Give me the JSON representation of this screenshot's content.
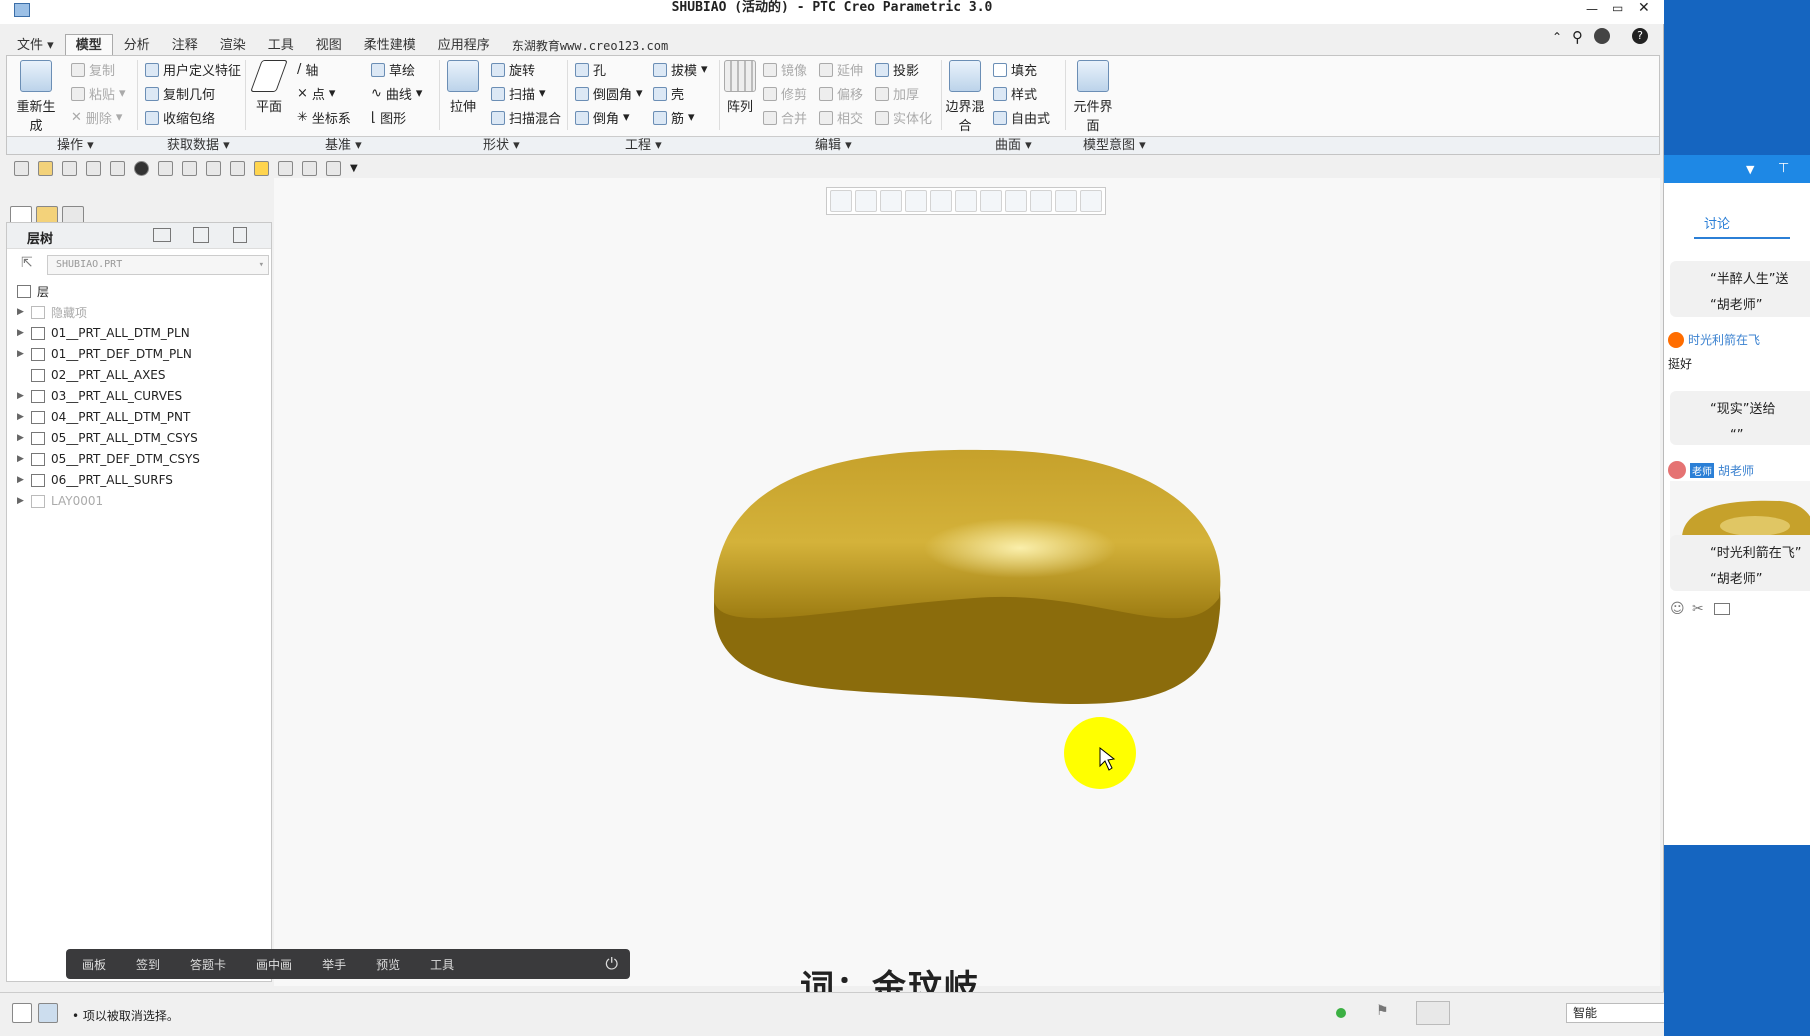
{
  "window": {
    "title": "SHUBIAO (活动的) - PTC Creo Parametric 3.0"
  },
  "menu_tabs": [
    "文件",
    "模型",
    "分析",
    "注释",
    "渲染",
    "工具",
    "视图",
    "柔性建模",
    "应用程序",
    "东湖教育www.creo123.com"
  ],
  "ribbon": {
    "regenerate": "重新生成",
    "ops": {
      "copy": "复制",
      "paste": "粘贴",
      "delete": "删除"
    },
    "getdata": {
      "udf": "用户定义特征",
      "copygeom": "复制几何",
      "shrinkwrap": "收缩包络"
    },
    "datum": {
      "plane": "平面",
      "axis": "轴",
      "point": "点",
      "csys": "坐标系",
      "sketch": "草绘",
      "curve": "曲线",
      "graph": "图形"
    },
    "shape": {
      "extrude": "拉伸",
      "revolve": "旋转",
      "sweep": "扫描",
      "sweepblend": "扫描混合"
    },
    "eng": {
      "hole": "孔",
      "round": "倒圆角",
      "chamfer": "倒角",
      "draft": "拔模",
      "shell": "壳",
      "rib": "筋"
    },
    "edit": {
      "pattern": "阵列",
      "mirror": "镜像",
      "trim": "修剪",
      "merge": "合并",
      "extend": "延伸",
      "offset": "偏移",
      "intersect": "相交",
      "project": "投影",
      "thicken": "加厚",
      "solidify": "实体化"
    },
    "surface": {
      "boundary": "边界混合",
      "fill": "填充",
      "style": "样式",
      "freeform": "自由式"
    },
    "intent": {
      "component": "元件界面"
    },
    "groups": [
      "操作",
      "获取数据",
      "基准",
      "形状",
      "工程",
      "编辑",
      "曲面",
      "模型意图"
    ]
  },
  "tree": {
    "title": "层树",
    "filter": "SHUBIAO.PRT",
    "root": "层",
    "items": [
      "隐藏项",
      "01__PRT_ALL_DTM_PLN",
      "01__PRT_DEF_DTM_PLN",
      "02__PRT_ALL_AXES",
      "03__PRT_ALL_CURVES",
      "04__PRT_ALL_DTM_PNT",
      "05__PRT_ALL_DTM_CSYS",
      "05__PRT_DEF_DTM_CSYS",
      "06__PRT_ALL_SURFS",
      "LAY0001"
    ]
  },
  "classbar": [
    "画板",
    "签到",
    "答题卡",
    "画中画",
    "举手",
    "预览",
    "工具"
  ],
  "lyric": "词：金玟岐",
  "status": {
    "message": "• 项以被取消选择。",
    "filter": "智能"
  },
  "chat": {
    "tab": "讨论",
    "m1": [
      "“半醉人生”送",
      "“胡老师”"
    ],
    "u1": "时光利箭在飞",
    "m2": "挺好",
    "m3": [
      "“现实”送给",
      "“”"
    ],
    "u2badge": "老师",
    "u2": "胡老师",
    "m4": [
      "“时光利箭在飞”",
      "“胡老师”"
    ]
  },
  "colors": {
    "model": "#c9a22e",
    "cursor_highlight": "#ffff00",
    "chat_blue": "#1e88e5"
  }
}
